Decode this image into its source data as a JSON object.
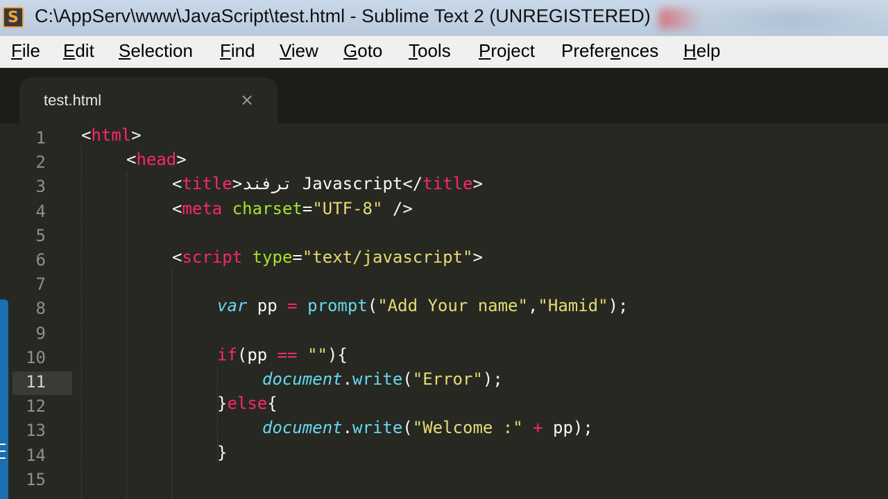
{
  "window": {
    "title": "C:\\AppServ\\www\\JavaScript\\test.html - Sublime Text 2 (UNREGISTERED)",
    "app_icon_letter": "S",
    "app_icon_name": "sublime-text-icon"
  },
  "menubar": {
    "items": [
      {
        "first": "F",
        "rest": "ile"
      },
      {
        "first": "E",
        "rest": "dit"
      },
      {
        "first": "S",
        "rest": "election"
      },
      {
        "first": "F",
        "rest": "ind"
      },
      {
        "first": "V",
        "rest": "iew"
      },
      {
        "first": "G",
        "rest": "oto"
      },
      {
        "first": "T",
        "rest": "ools"
      },
      {
        "first": "P",
        "rest": "roject"
      },
      {
        "pre": "Prefer",
        "first": "e",
        "rest": "nces"
      },
      {
        "first": "H",
        "rest": "elp"
      }
    ]
  },
  "tab": {
    "label": "test.html",
    "close": "×"
  },
  "editor": {
    "line_numbers": [
      "1",
      "2",
      "3",
      "4",
      "5",
      "6",
      "7",
      "8",
      "9",
      "10",
      "11",
      "12",
      "13",
      "14",
      "15"
    ],
    "current_line": "11",
    "lines": [
      {
        "n": "1",
        "tokens": [
          [
            "p",
            "<"
          ],
          [
            "t",
            "html"
          ],
          [
            "p",
            ">"
          ]
        ]
      },
      {
        "n": "2",
        "tokens": [
          [
            "p",
            "<"
          ],
          [
            "t",
            "head"
          ],
          [
            "p",
            ">"
          ]
        ]
      },
      {
        "n": "3",
        "tokens": [
          [
            "p",
            "<"
          ],
          [
            "t",
            "title"
          ],
          [
            "p",
            ">ترفند Javascript</"
          ],
          [
            "t",
            "title"
          ],
          [
            "p",
            ">"
          ]
        ]
      },
      {
        "n": "4",
        "tokens": [
          [
            "p",
            "<"
          ],
          [
            "t",
            "meta"
          ],
          [
            "w",
            " "
          ],
          [
            "a",
            "charset"
          ],
          [
            "p",
            "="
          ],
          [
            "s",
            "\"UTF-8\""
          ],
          [
            "p",
            " />"
          ]
        ]
      },
      {
        "n": "5",
        "tokens": []
      },
      {
        "n": "6",
        "tokens": [
          [
            "p",
            "<"
          ],
          [
            "t",
            "script"
          ],
          [
            "w",
            " "
          ],
          [
            "a",
            "type"
          ],
          [
            "p",
            "="
          ],
          [
            "s",
            "\"text/javascript\""
          ],
          [
            "p",
            ">"
          ]
        ]
      },
      {
        "n": "7",
        "tokens": []
      },
      {
        "n": "8",
        "tokens": [
          [
            "v",
            "var"
          ],
          [
            "w",
            " pp "
          ],
          [
            "k",
            "="
          ],
          [
            "w",
            " "
          ],
          [
            "f",
            "prompt"
          ],
          [
            "w",
            "("
          ],
          [
            "s",
            "\"Add Your name\""
          ],
          [
            "w",
            ","
          ],
          [
            "s",
            "\"Hamid\""
          ],
          [
            "w",
            ");"
          ]
        ]
      },
      {
        "n": "9",
        "tokens": []
      },
      {
        "n": "10",
        "tokens": [
          [
            "k",
            "if"
          ],
          [
            "w",
            "(pp "
          ],
          [
            "k",
            "=="
          ],
          [
            "w",
            " "
          ],
          [
            "s",
            "\"\""
          ],
          [
            "w",
            "){"
          ]
        ]
      },
      {
        "n": "11",
        "tokens": [
          [
            "v",
            "document"
          ],
          [
            "w",
            "."
          ],
          [
            "f",
            "write"
          ],
          [
            "w",
            "("
          ],
          [
            "s",
            "\"Error\""
          ],
          [
            "w",
            ");"
          ]
        ]
      },
      {
        "n": "12",
        "tokens": [
          [
            "w",
            "}"
          ],
          [
            "k",
            "else"
          ],
          [
            "w",
            "{"
          ]
        ]
      },
      {
        "n": "13",
        "tokens": [
          [
            "v",
            "document"
          ],
          [
            "w",
            "."
          ],
          [
            "f",
            "write"
          ],
          [
            "w",
            "("
          ],
          [
            "s",
            "\"Welcome :\""
          ],
          [
            "w",
            " "
          ],
          [
            "k",
            "+"
          ],
          [
            "w",
            " pp);"
          ]
        ]
      },
      {
        "n": "14",
        "tokens": [
          [
            "w",
            "}"
          ]
        ]
      },
      {
        "n": "15",
        "tokens": []
      }
    ]
  },
  "colors": {
    "background": "#272822",
    "tag": "#f92672",
    "attribute": "#a6e22e",
    "string": "#e6db74",
    "function": "#66d9ef",
    "plain": "#f8f8f2",
    "line_number": "#8f908a"
  }
}
